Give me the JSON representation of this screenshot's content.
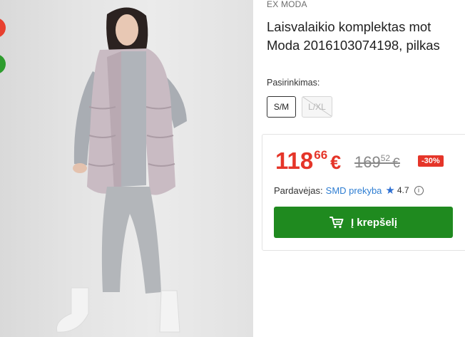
{
  "product": {
    "brand": "EX MODA",
    "title_line1": "Laisvalaikio komplektas mot",
    "title_line2": "Moda 2016103074198, pilkas"
  },
  "options": {
    "label": "Pasirinkimas:",
    "items": [
      {
        "label": "S/M",
        "available": true
      },
      {
        "label": "L/XL",
        "available": false
      }
    ]
  },
  "price": {
    "current_main": "118",
    "current_cents": "66",
    "currency": "€",
    "old_main": "169",
    "old_cents": "52",
    "discount": "-30%"
  },
  "seller": {
    "label": "Pardavėjas:",
    "name": "SMD prekyba",
    "rating": "4.7"
  },
  "cart": {
    "button_label": "Į krepšelį"
  },
  "colors": {
    "price": "#e53529",
    "button": "#1f8a1f",
    "link": "#2d7dd2"
  }
}
